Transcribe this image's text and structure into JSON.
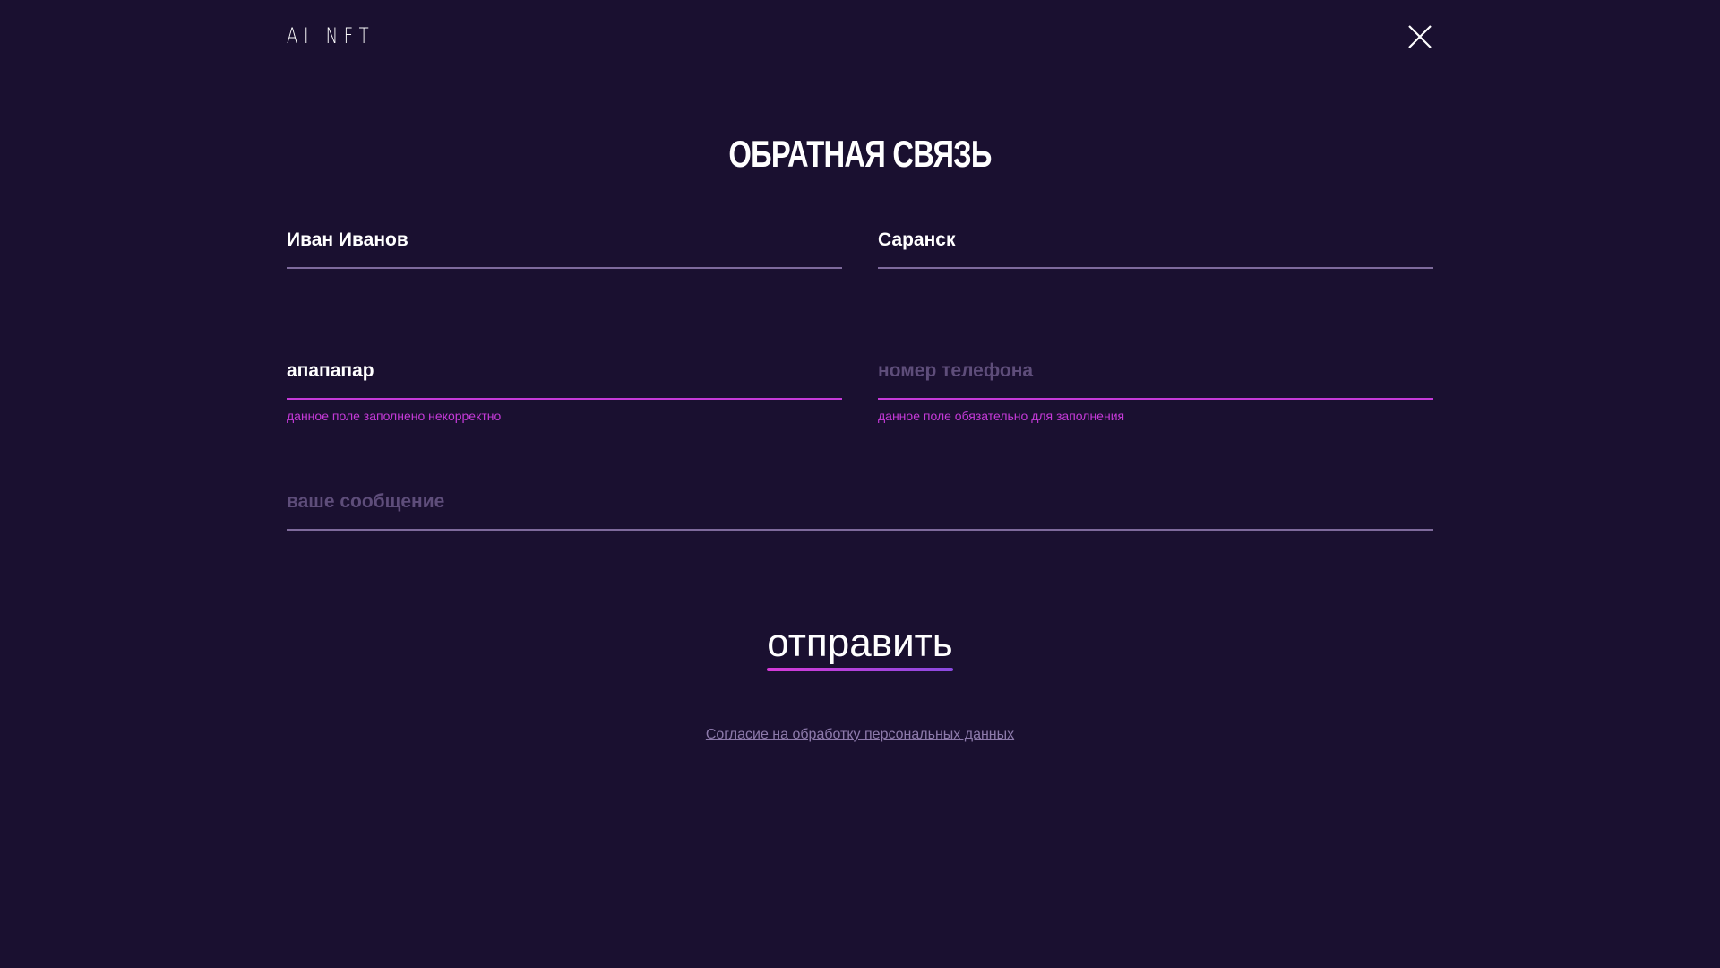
{
  "header": {
    "logo_text": "AI NFT",
    "close_icon": "close-icon"
  },
  "form": {
    "title": "ОБРАТНАЯ СВЯЗЬ",
    "name": {
      "value": "Иван Иванов",
      "placeholder": ""
    },
    "city": {
      "value": "Саранск",
      "placeholder": ""
    },
    "email": {
      "value": "апапапар",
      "placeholder": "",
      "error": "данное поле заполнено некорректно"
    },
    "phone": {
      "value": "",
      "placeholder": "номер телефона",
      "error": "данное поле обязательно для заполнения"
    },
    "message": {
      "value": "",
      "placeholder": "ваше сообщение"
    },
    "submit_label": "отправить",
    "consent_link": "Согласие на обработку персональных данных"
  },
  "colors": {
    "background": "#1a1030",
    "error": "#c53ad8",
    "line": "#7e6a9c",
    "accent_gradient_start": "#d63ad8",
    "accent_gradient_end": "#8a4ae0"
  }
}
